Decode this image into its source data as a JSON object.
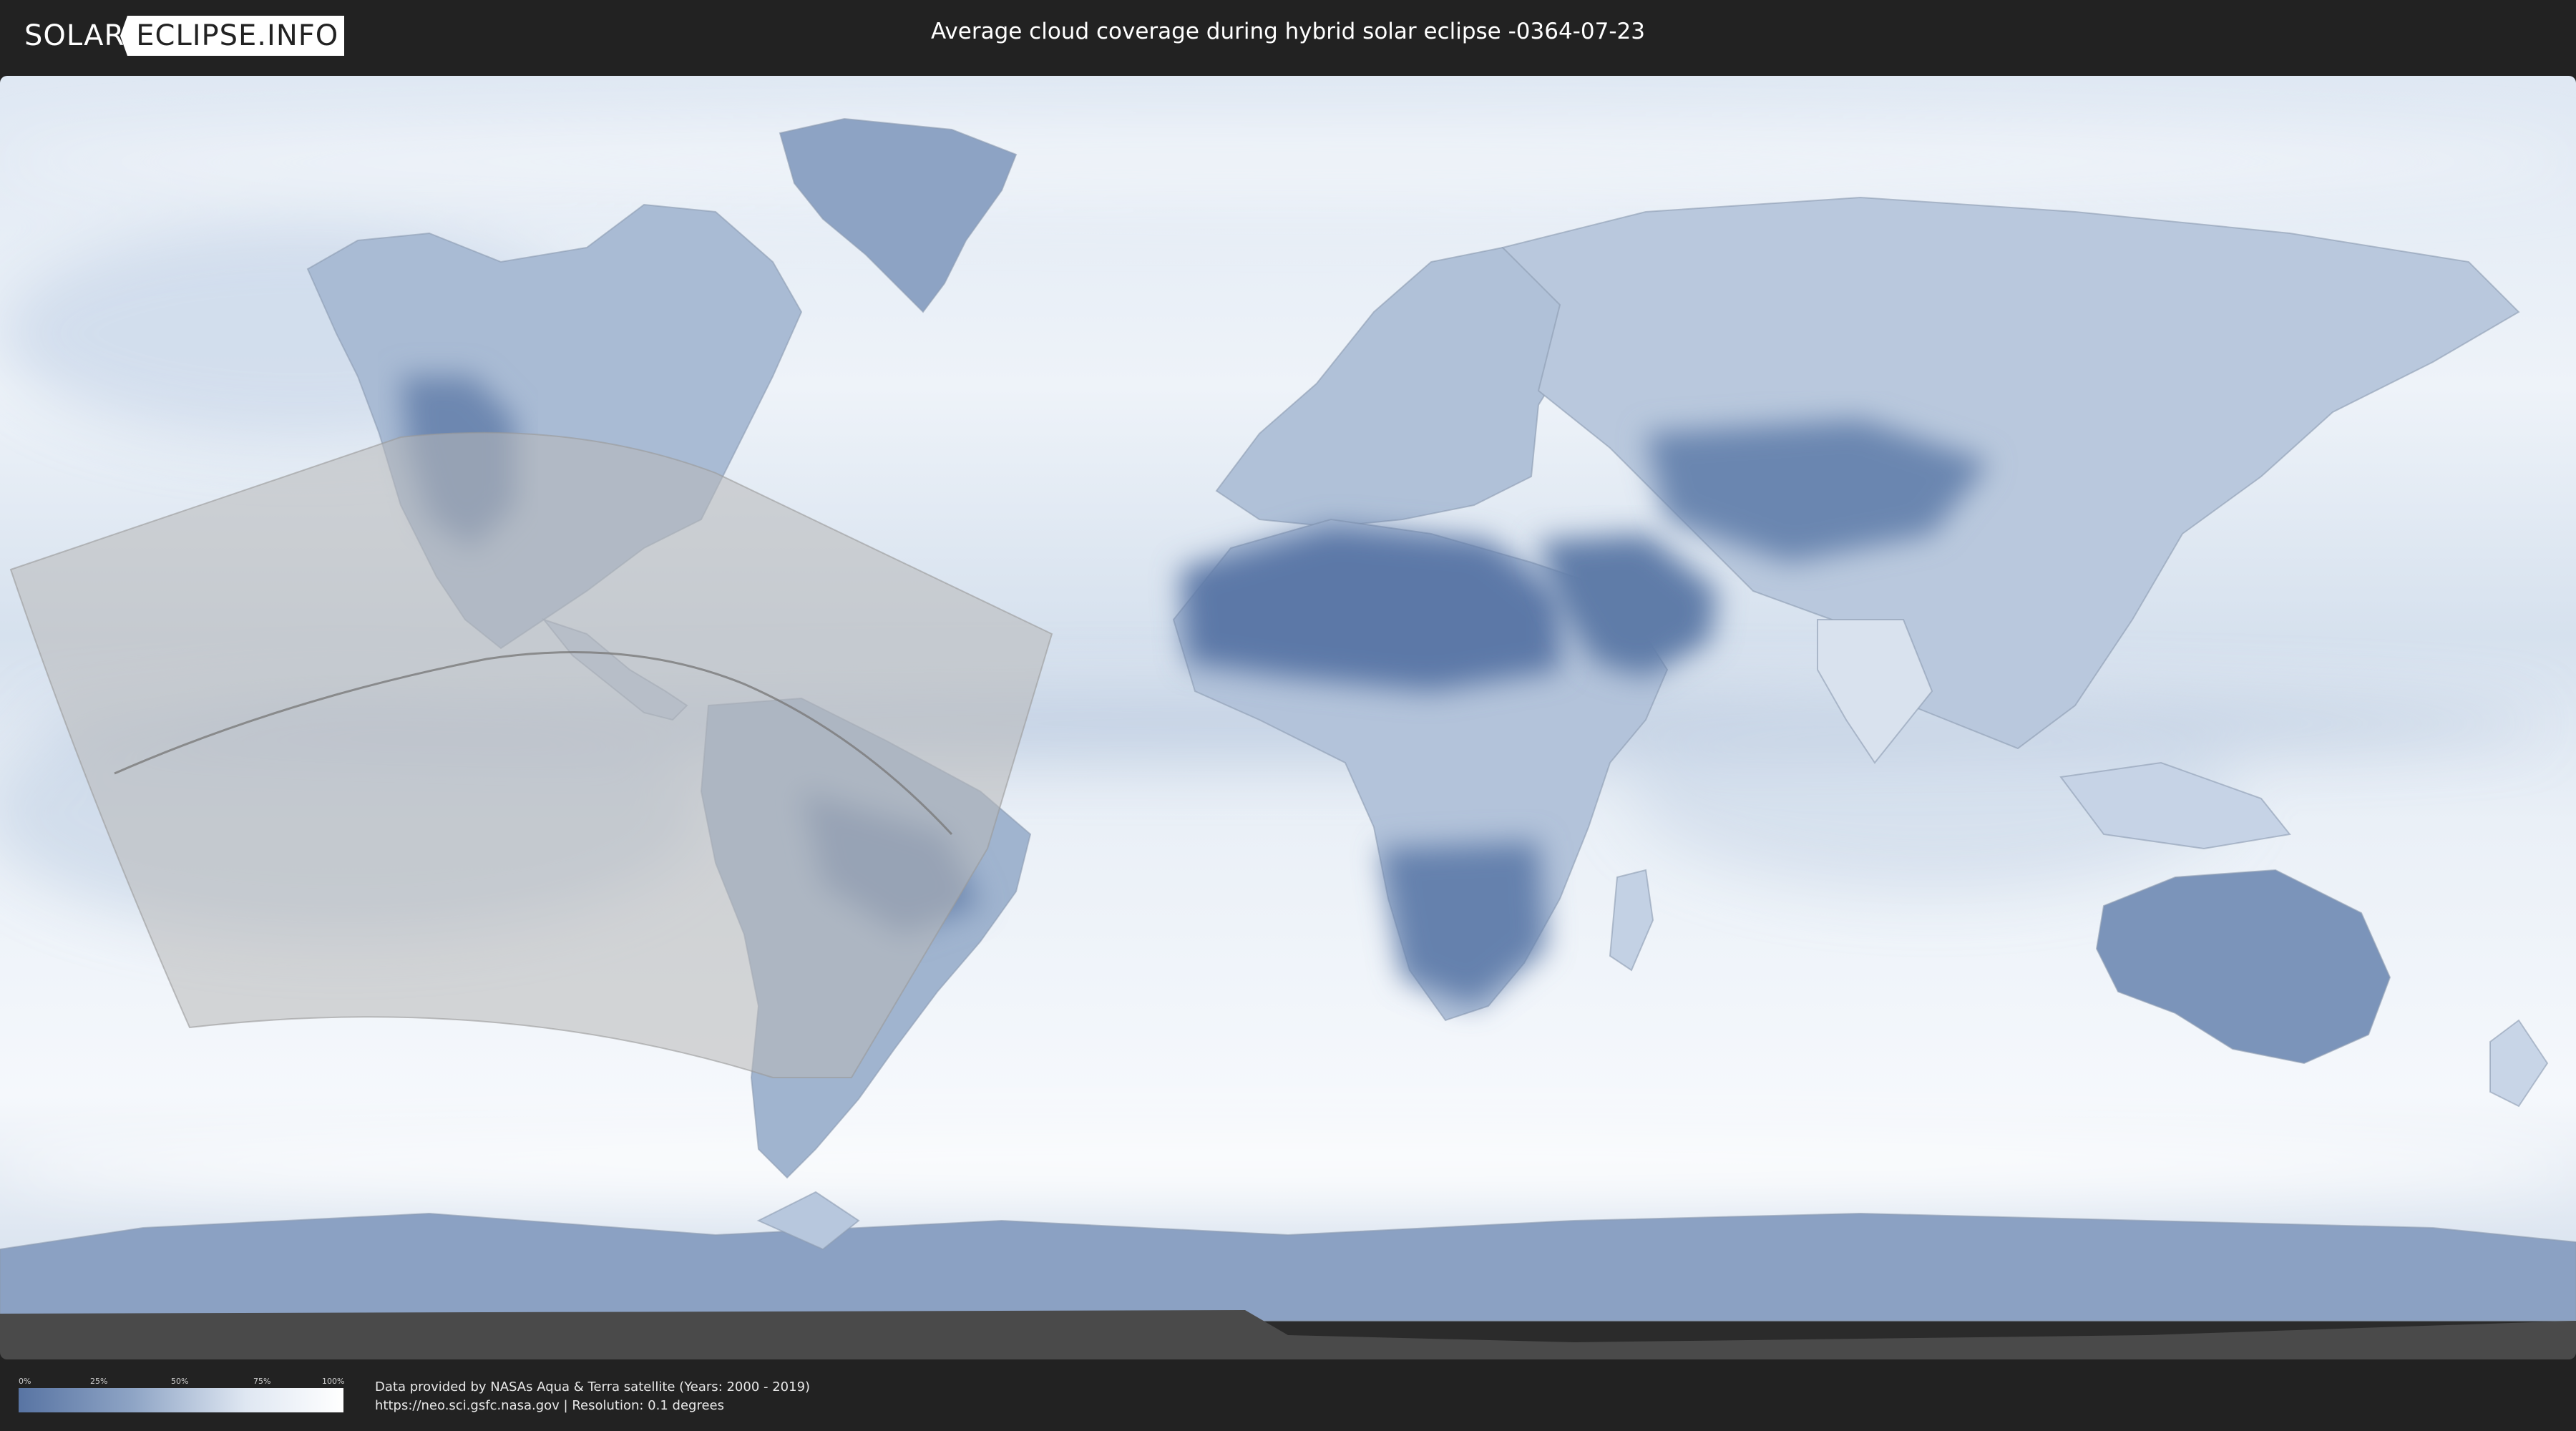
{
  "header": {
    "logo_left": "SOLAR",
    "logo_right": "ECLIPSE.INFO",
    "title": "Average cloud coverage during hybrid solar eclipse -0364-07-23"
  },
  "legend": {
    "ticks": [
      "0%",
      "25%",
      "50%",
      "75%",
      "100%"
    ],
    "colors": {
      "low": "#5874a3",
      "high": "#ffffff"
    }
  },
  "credits": {
    "line1": "Data provided by NASAs Aqua & Terra satellite (Years: 2000 - 2019)",
    "line2": "https://neo.sci.gsfc.nasa.gov | Resolution: 0.1 degrees"
  },
  "colors": {
    "background": "#222222",
    "ocean_clear": "#eef3f9",
    "cloud_low": "#5874a3",
    "eclipse_zone": "#b8b8b8"
  }
}
